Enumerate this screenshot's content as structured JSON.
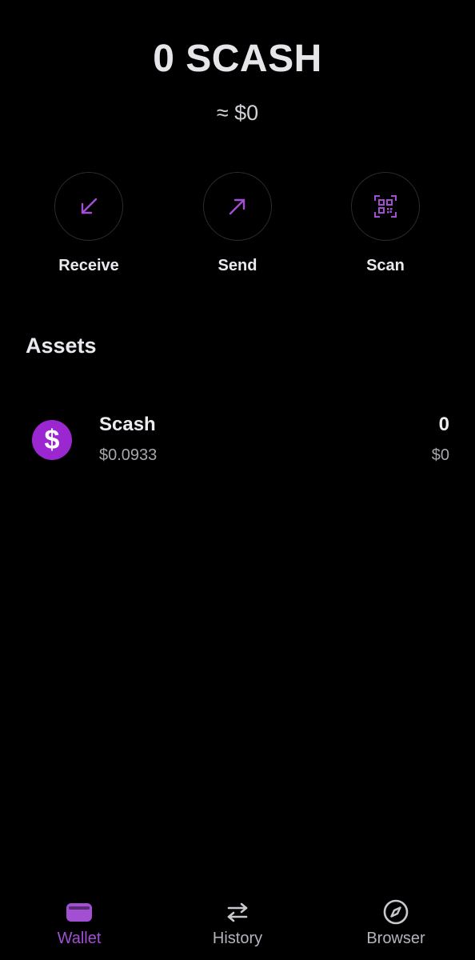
{
  "header": {
    "balance": "0 SCASH",
    "fiat_balance": "≈ $0"
  },
  "actions": [
    {
      "label": "Receive",
      "icon": "arrow-down-left-icon"
    },
    {
      "label": "Send",
      "icon": "arrow-up-right-icon"
    },
    {
      "label": "Scan",
      "icon": "qr-scan-icon"
    }
  ],
  "assets": {
    "title": "Assets",
    "items": [
      {
        "logo_glyph": "$",
        "name": "Scash",
        "price": "$0.0933",
        "amount": "0",
        "value": "$0"
      }
    ]
  },
  "nav": [
    {
      "label": "Wallet",
      "icon": "wallet-icon",
      "active": true
    },
    {
      "label": "History",
      "icon": "swap-arrows-icon",
      "active": false
    },
    {
      "label": "Browser",
      "icon": "compass-icon",
      "active": false
    }
  ],
  "colors": {
    "background": "#000000",
    "accent": "#a24fd4",
    "coin_logo": "#9b27d0",
    "text_primary": "#e9e9ee",
    "text_secondary": "#a6a6ae"
  }
}
